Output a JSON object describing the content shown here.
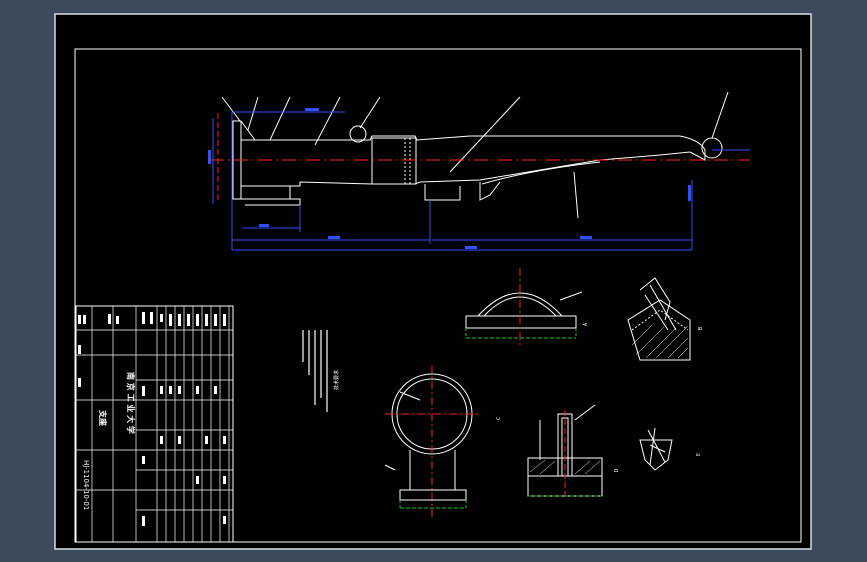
{
  "viewport": {
    "background_color": "#3d4a5c",
    "frame_color": "#d8dde6",
    "paper_color": "#000000",
    "line_color": "#ffffff",
    "centerline_color": "#ff2020",
    "dimension_color": "#3050ff",
    "section_base_color": "#20c020"
  },
  "drawing": {
    "title_block": {
      "school": "南 京 工 业 大 学",
      "drawing_title": "支座",
      "drawing_number": "HJ-1104-10-01"
    },
    "views": {
      "main_view": "main-elevation",
      "detail_a": "A",
      "detail_b": "B",
      "detail_c": "C",
      "detail_d": "D",
      "detail_e": "E"
    },
    "notes_title": "技术要求"
  }
}
